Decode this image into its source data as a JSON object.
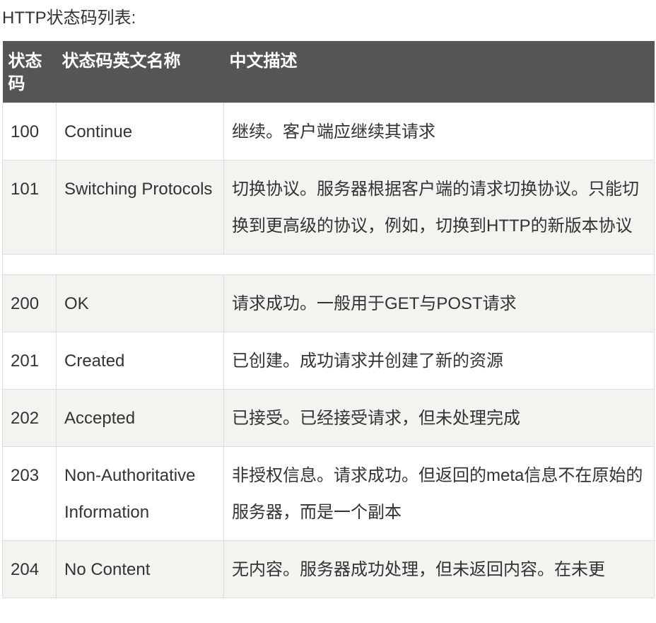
{
  "caption": "HTTP状态码列表:",
  "table": {
    "headers": [
      "状态码",
      "状态码英文名称",
      "中文描述"
    ],
    "rows": [
      {
        "code": "100",
        "name": "Continue",
        "desc": "继续。客户端应继续其请求"
      },
      {
        "code": "101",
        "name": "Switching Protocols",
        "desc": "切换协议。服务器根据客户端的请求切换协议。只能切换到更高级的协议，例如，切换到HTTP的新版本协议"
      },
      {
        "code": "200",
        "name": "OK",
        "desc": "请求成功。一般用于GET与POST请求"
      },
      {
        "code": "201",
        "name": "Created",
        "desc": "已创建。成功请求并创建了新的资源"
      },
      {
        "code": "202",
        "name": "Accepted",
        "desc": "已接受。已经接受请求，但未处理完成"
      },
      {
        "code": "203",
        "name": "Non-Authoritative Information",
        "desc": "非授权信息。请求成功。但返回的meta信息不在原始的服务器，而是一个副本"
      },
      {
        "code": "204",
        "name": "No Content",
        "desc": "无内容。服务器成功处理，但未返回内容。在未更"
      }
    ]
  }
}
